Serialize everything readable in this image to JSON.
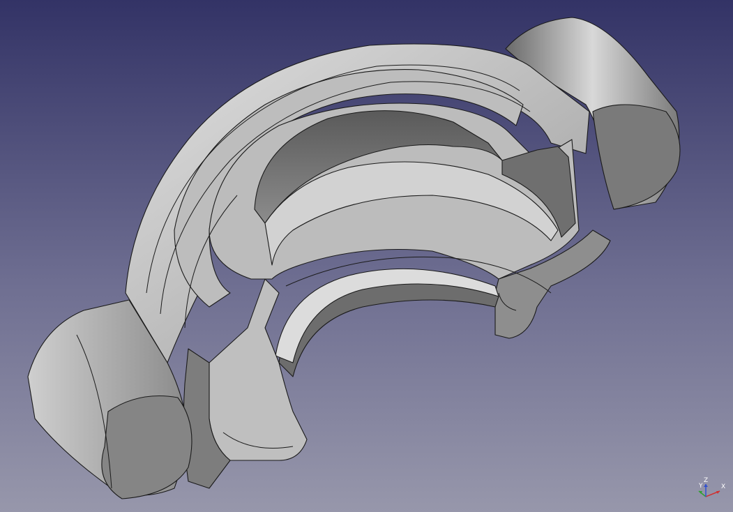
{
  "viewport": {
    "background_top": "#333366",
    "background_bottom": "#9797ab",
    "model_color": "#b4b4b4",
    "edge_color": "#1a1a1a"
  },
  "axis_triad": {
    "x_label": "X",
    "y_label": "Y",
    "z_label": "Z",
    "x_color": "#d03030",
    "y_color": "#30a030",
    "z_color": "#3050d0"
  }
}
